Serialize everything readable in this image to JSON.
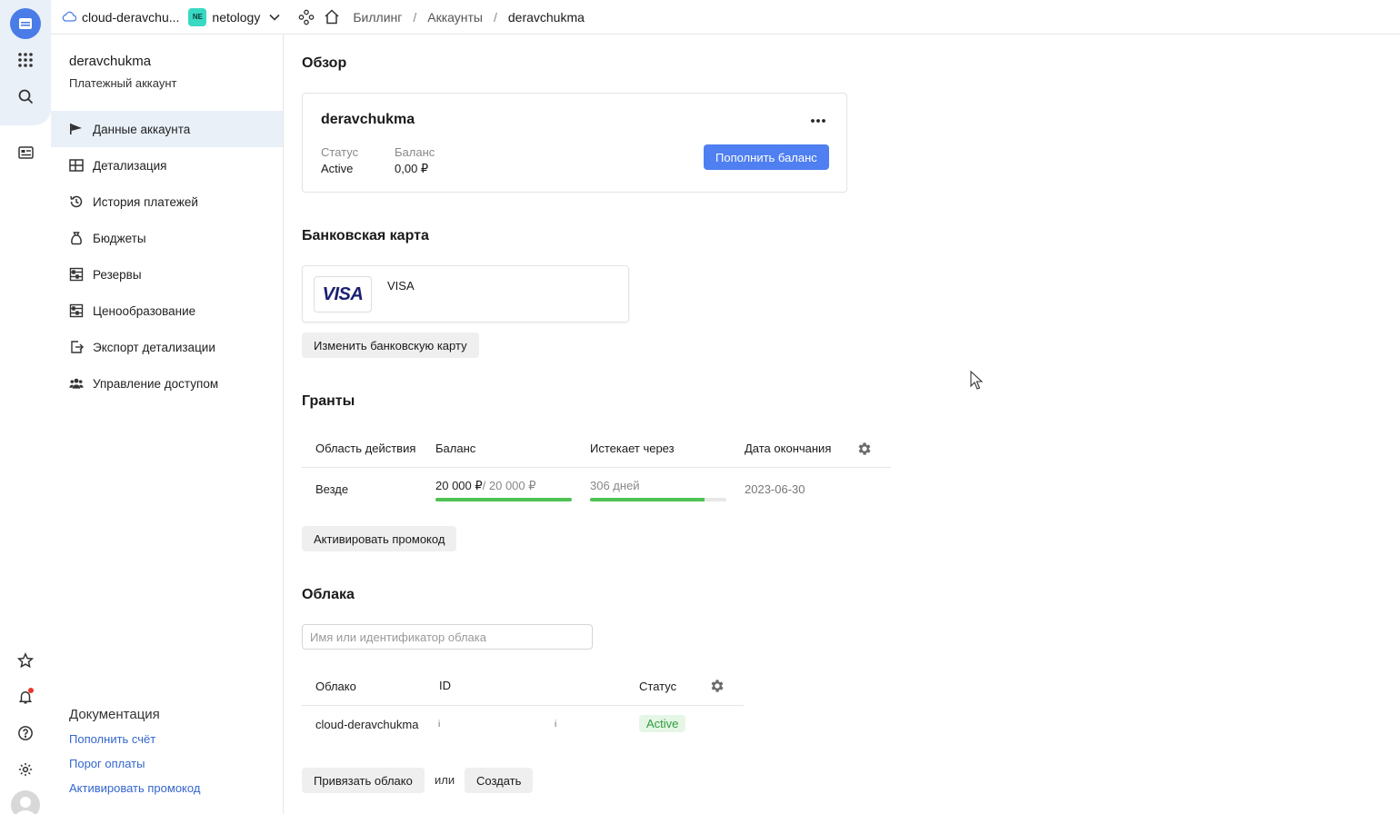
{
  "header": {
    "cloud_name": "cloud-deravchu...",
    "org_badge": "NE",
    "org_name": "netology",
    "breadcrumbs": [
      "Биллинг",
      "Аккаунты",
      "deravchukma"
    ]
  },
  "sidebar": {
    "account_name": "deravchukma",
    "account_type": "Платежный аккаунт",
    "items": [
      {
        "label": "Данные аккаунта",
        "icon": "flag-icon",
        "active": true
      },
      {
        "label": "Детализация",
        "icon": "table-icon"
      },
      {
        "label": "История платежей",
        "icon": "history-icon"
      },
      {
        "label": "Бюджеты",
        "icon": "bag-icon"
      },
      {
        "label": "Резервы",
        "icon": "abacus-icon"
      },
      {
        "label": "Ценообразование",
        "icon": "abacus-icon"
      },
      {
        "label": "Экспорт детализации",
        "icon": "export-icon"
      },
      {
        "label": "Управление доступом",
        "icon": "people-icon"
      }
    ],
    "docs_title": "Документация",
    "docs_links": [
      "Пополнить счёт",
      "Порог оплаты",
      "Активировать промокод"
    ]
  },
  "overview": {
    "title": "Обзор",
    "account_name": "deravchukma",
    "status_label": "Статус",
    "status_value": "Active",
    "balance_label": "Баланс",
    "balance_value": "0,00 ₽",
    "topup_button": "Пополнить баланс"
  },
  "bank_card": {
    "title": "Банковская карта",
    "brand": "VISA",
    "card_label": "VISA",
    "change_button": "Изменить банковскую карту"
  },
  "grants": {
    "title": "Гранты",
    "columns": [
      "Область действия",
      "Баланс",
      "Истекает через",
      "Дата окончания"
    ],
    "rows": [
      {
        "scope": "Везде",
        "balance_current": "20 000 ₽",
        "balance_total": "/ 20 000 ₽",
        "balance_fraction": 1.0,
        "expires_in": "306 дней",
        "expires_fraction": 0.84,
        "end_date": "2023-06-30"
      }
    ],
    "activate_button": "Активировать промокод"
  },
  "clouds": {
    "title": "Облака",
    "search_placeholder": "Имя или идентификатор облака",
    "columns": [
      "Облако",
      "ID",
      "Статус"
    ],
    "rows": [
      {
        "name": "cloud-deravchukma",
        "id_marker": "i",
        "id_marker2": "i",
        "status": "Active"
      }
    ],
    "bind_button": "Привязать облако",
    "or_text": "или",
    "create_button": "Создать"
  },
  "colors": {
    "primary": "#4f7ff0",
    "active_green": "#2e9e3a",
    "progress_green": "#4fc254",
    "rail_bg": "#eaf0f8"
  }
}
